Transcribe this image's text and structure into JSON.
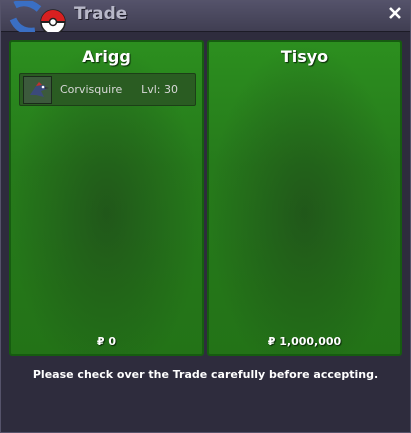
{
  "window": {
    "title": "Trade"
  },
  "left": {
    "trainer": "Arigg",
    "money": "₽ 0",
    "pokemon": [
      {
        "name": "Corvisquire",
        "level": "Lvl: 30"
      }
    ]
  },
  "right": {
    "trainer": "Tisyo",
    "money": "₽ 1,000,000"
  },
  "footer": {
    "message": "Please check over the Trade carefully before accepting."
  },
  "icons": {
    "logo": "pokeball-logo-icon",
    "close": "close-icon",
    "sprite": "corvisquire-sprite-icon"
  },
  "colors": {
    "panel_green": "#2c8f1f",
    "title_text": "#b8b8c8"
  }
}
